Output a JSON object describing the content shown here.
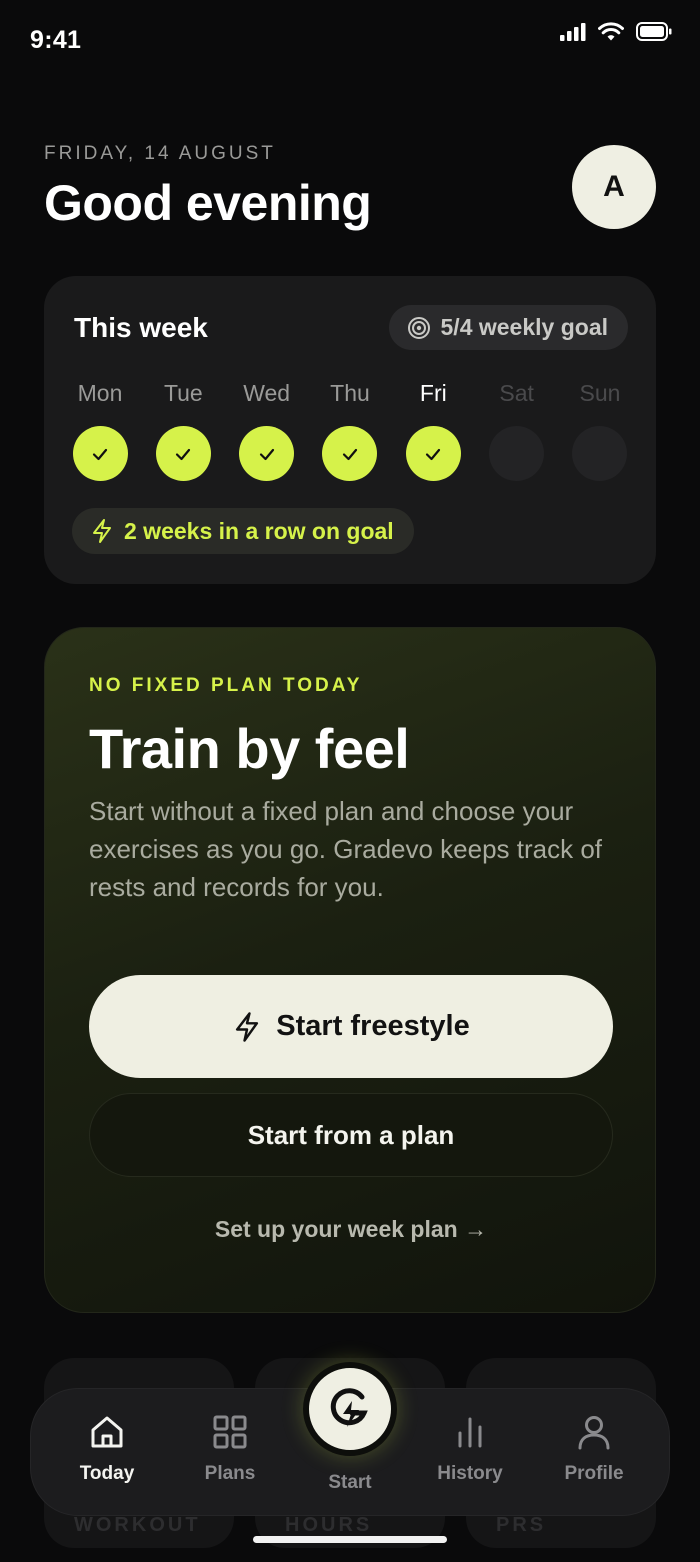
{
  "status_bar": {
    "time": "9:41"
  },
  "header": {
    "date": "FRIDAY, 14 AUGUST",
    "greeting": "Good evening",
    "avatar_initial": "A"
  },
  "week": {
    "title": "This week",
    "goal_label": "5/4 weekly goal",
    "days": [
      {
        "label": "Mon",
        "state": "done"
      },
      {
        "label": "Tue",
        "state": "done"
      },
      {
        "label": "Wed",
        "state": "done"
      },
      {
        "label": "Thu",
        "state": "done"
      },
      {
        "label": "Fri",
        "state": "done"
      },
      {
        "label": "Sat",
        "state": "future"
      },
      {
        "label": "Sun",
        "state": "future"
      }
    ],
    "streak_label": "2 weeks in a row on goal"
  },
  "feel_card": {
    "eyebrow": "NO FIXED PLAN TODAY",
    "title": "Train by feel",
    "body": "Start without a fixed plan and choose your exercises as you go. Gradevo keeps track of rests and records for you.",
    "primary_button": "Start freestyle",
    "secondary_button": "Start from a plan",
    "setup_link": "Set up your week plan →"
  },
  "stats_peek": {
    "labels": [
      "WORKOUT",
      "HOURS",
      "PRS"
    ]
  },
  "nav": {
    "items": [
      {
        "label": "Today",
        "icon": "home-icon",
        "active": true
      },
      {
        "label": "Plans",
        "icon": "grid-icon",
        "active": false
      },
      {
        "label": "Start",
        "icon": "bolt-logo-icon",
        "active": false
      },
      {
        "label": "History",
        "icon": "bar-chart-icon",
        "active": false
      },
      {
        "label": "Profile",
        "icon": "person-icon",
        "active": false
      }
    ]
  },
  "colors": {
    "accent": "#d6f24a",
    "background": "#0a0a0b",
    "card": "#1a1a1b",
    "button_light": "#efefe2"
  }
}
